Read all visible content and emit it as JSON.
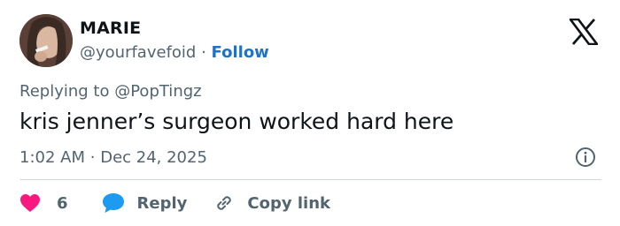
{
  "author": {
    "name": "MARIE",
    "handle": "@yourfavefoid",
    "separator": "·",
    "follow_label": "Follow"
  },
  "reply_context": {
    "prefix": "Replying to",
    "handle": "@PopTingz"
  },
  "tweet": {
    "text": "kris jenner’s surgeon worked hard here",
    "time": "1:02 AM",
    "separator": "·",
    "date": "Dec 24, 2025"
  },
  "actions": {
    "like_count": "6",
    "reply_label": "Reply",
    "copy_link_label": "Copy link"
  },
  "icons": {
    "platform": "x-logo-icon",
    "info": "info-icon",
    "like": "heart-icon",
    "reply": "speech-bubble-icon",
    "copy_link": "link-icon"
  },
  "colors": {
    "text_primary": "#0f1419",
    "text_secondary": "#536471",
    "follow_blue": "#1d73c9",
    "like_pink": "#f91880",
    "reply_blue": "#1d9bf0",
    "divider": "#cfd9de"
  }
}
